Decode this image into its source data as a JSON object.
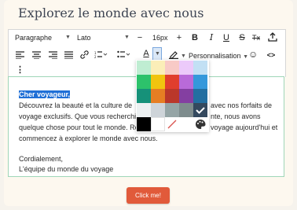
{
  "page": {
    "title": "Explorez le monde avec nous"
  },
  "toolbar": {
    "block_format": "Paragraphe",
    "font_family": "Lato",
    "font_size": "16px",
    "decrease": "−",
    "increase": "+",
    "bold": "B",
    "italic": "I",
    "underline": "U",
    "strikethrough": "S",
    "clear_format": "Tx",
    "more": "⋮",
    "personalize": "Personnalisation",
    "emoji": "☺",
    "code": "<>"
  },
  "editor": {
    "lines": [
      {
        "type": "highlight",
        "text": "Cher voyageur,"
      },
      {
        "text": "Découvrez la beauté et la culture de",
        "tail": "avec nos forfaits de"
      },
      {
        "text": "voyage exclusifs. Que vous recherchie",
        "tail": "nte, nous avons"
      },
      {
        "text": "quelque chose pour tout le monde. Ré",
        "tail": "voyage aujourd'hui et"
      },
      {
        "text": "commencez à explorer le monde avec nous.",
        "tail": ""
      },
      {
        "text": "",
        "tail": ""
      },
      {
        "text": "Cordialement,",
        "tail": ""
      },
      {
        "text": "L'équipe du monde du voyage",
        "tail": ""
      }
    ]
  },
  "palette": {
    "colors": [
      [
        "#bfedd2",
        "#fbeeb8",
        "#f8cac6",
        "#eccafa",
        "#c2e0f4"
      ],
      [
        "#2dc26b",
        "#f1c40f",
        "#e03e2d",
        "#b96ad9",
        "#3598db"
      ],
      [
        "#169179",
        "#e67e23",
        "#ba372a",
        "#843fa1",
        "#236fa1"
      ],
      [
        "#ecf0f1",
        "#ced4d9",
        "#95a5a6",
        "#7e8c8d",
        "#34495e"
      ],
      [
        "#000000",
        "#ffffff"
      ]
    ],
    "selected": "#34495e",
    "remove_color": "remove-color",
    "custom_color": "custom-color"
  },
  "cta": {
    "label": "Click me!"
  }
}
